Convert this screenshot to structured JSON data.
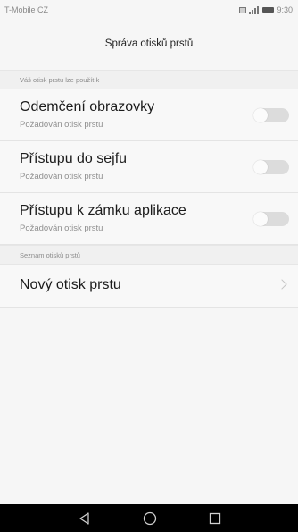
{
  "status_bar": {
    "carrier": "T-Mobile CZ",
    "time": "9:30",
    "icons": [
      "sim-icon",
      "signal-icon",
      "battery-icon"
    ]
  },
  "header": {
    "title": "Správa otisků prstů"
  },
  "section_use": {
    "label": "Váš otisk prstu lze použít k"
  },
  "options": [
    {
      "title": "Odemčení obrazovky",
      "subtitle": "Požadován otisk prstu",
      "enabled": false
    },
    {
      "title": "Přístupu do sejfu",
      "subtitle": "Požadován otisk prstu",
      "enabled": false
    },
    {
      "title": "Přístupu k zámku aplikace",
      "subtitle": "Požadován otisk prstu",
      "enabled": false
    }
  ],
  "section_list": {
    "label": "Seznam otisků prstů"
  },
  "new_fingerprint": {
    "label": "Nový otisk prstu"
  },
  "nav_bar": {
    "buttons": [
      "back-icon",
      "home-icon",
      "recents-icon"
    ]
  },
  "colors": {
    "background": "#f6f6f6",
    "toggle_off": "#dcdcdc",
    "nav_bar": "#000000"
  }
}
